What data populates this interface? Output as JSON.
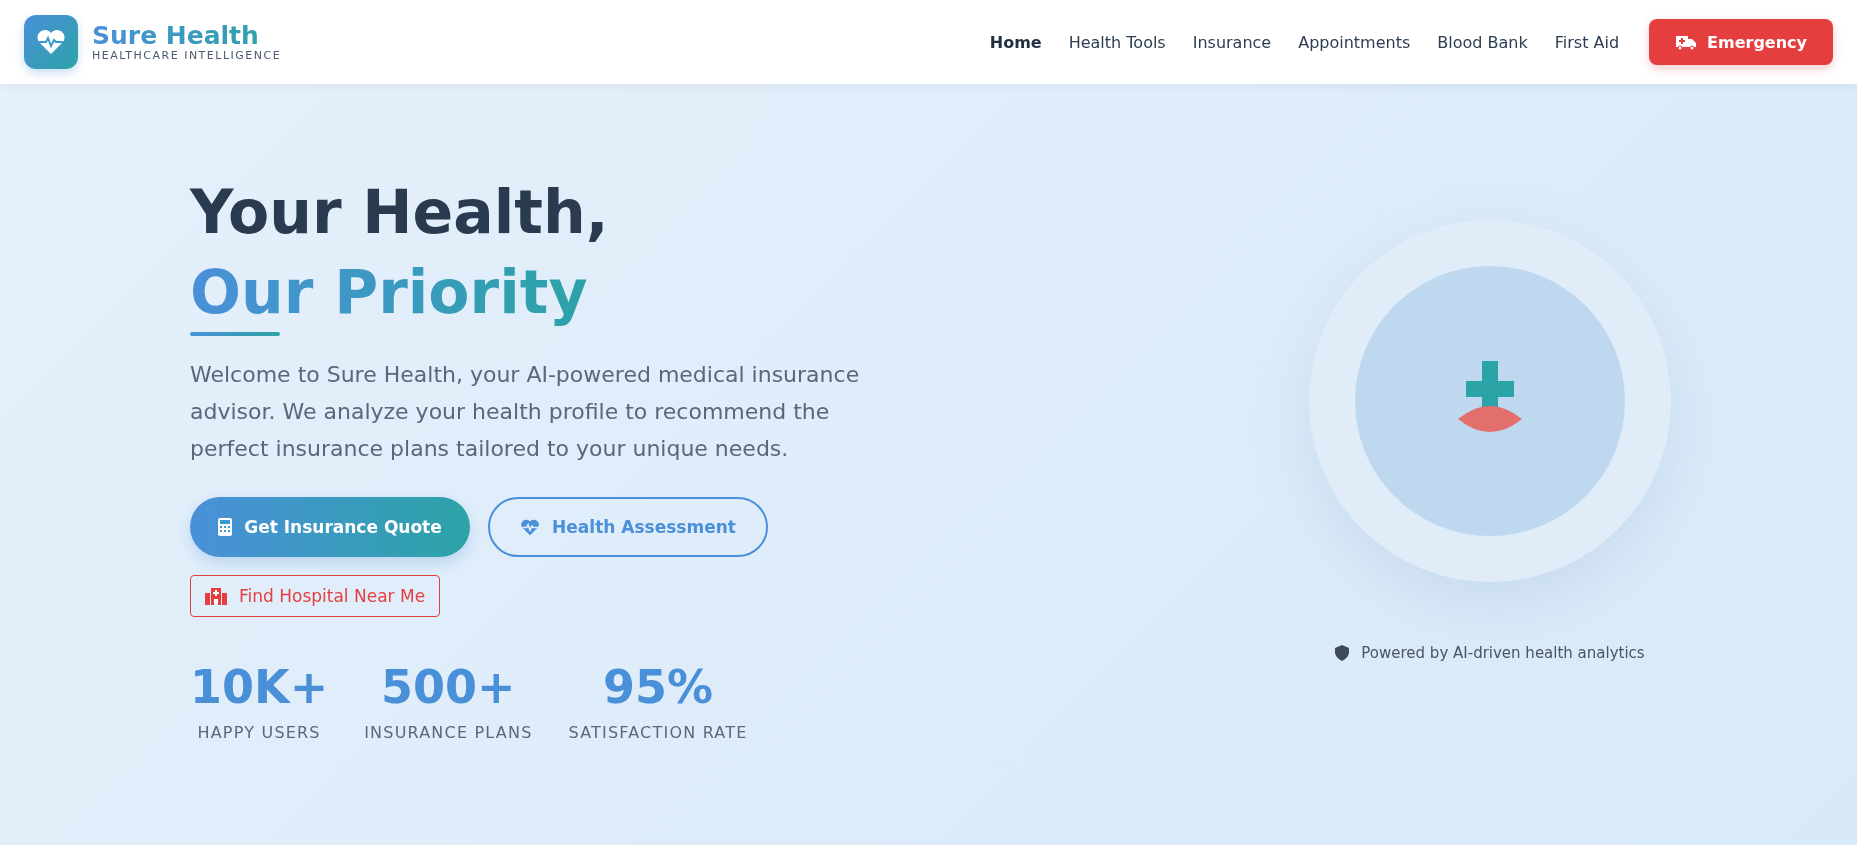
{
  "brand": {
    "name": "Sure Health",
    "tagline": "HEALTHCARE INTELLIGENCE"
  },
  "nav": [
    {
      "label": "Home",
      "selected": true
    },
    {
      "label": "Health Tools",
      "selected": false
    },
    {
      "label": "Insurance",
      "selected": false
    },
    {
      "label": "Appointments",
      "selected": false
    },
    {
      "label": "Blood Bank",
      "selected": false
    },
    {
      "label": "First Aid",
      "selected": false
    }
  ],
  "emergency_button": "Emergency",
  "hero": {
    "title_line_1": "Your Health,",
    "title_line_2": "Our Priority",
    "description": "Welcome to Sure Health, your AI-powered medical insurance advisor. We analyze your health profile to recommend the perfect insurance plans tailored to your unique needs.",
    "buttons": [
      {
        "label": "Get Insurance Quote",
        "kind": "primary"
      },
      {
        "label": "Health Assessment",
        "kind": "outline"
      },
      {
        "label": "Find Hospital Near Me",
        "kind": "hospital"
      }
    ],
    "stats": [
      {
        "value": "10K+",
        "label": "HAPPY USERS"
      },
      {
        "value": "500+",
        "label": "INSURANCE PLANS"
      },
      {
        "value": "95%",
        "label": "SATISFACTION RATE"
      }
    ]
  },
  "caption": "Powered by AI-driven health analytics"
}
